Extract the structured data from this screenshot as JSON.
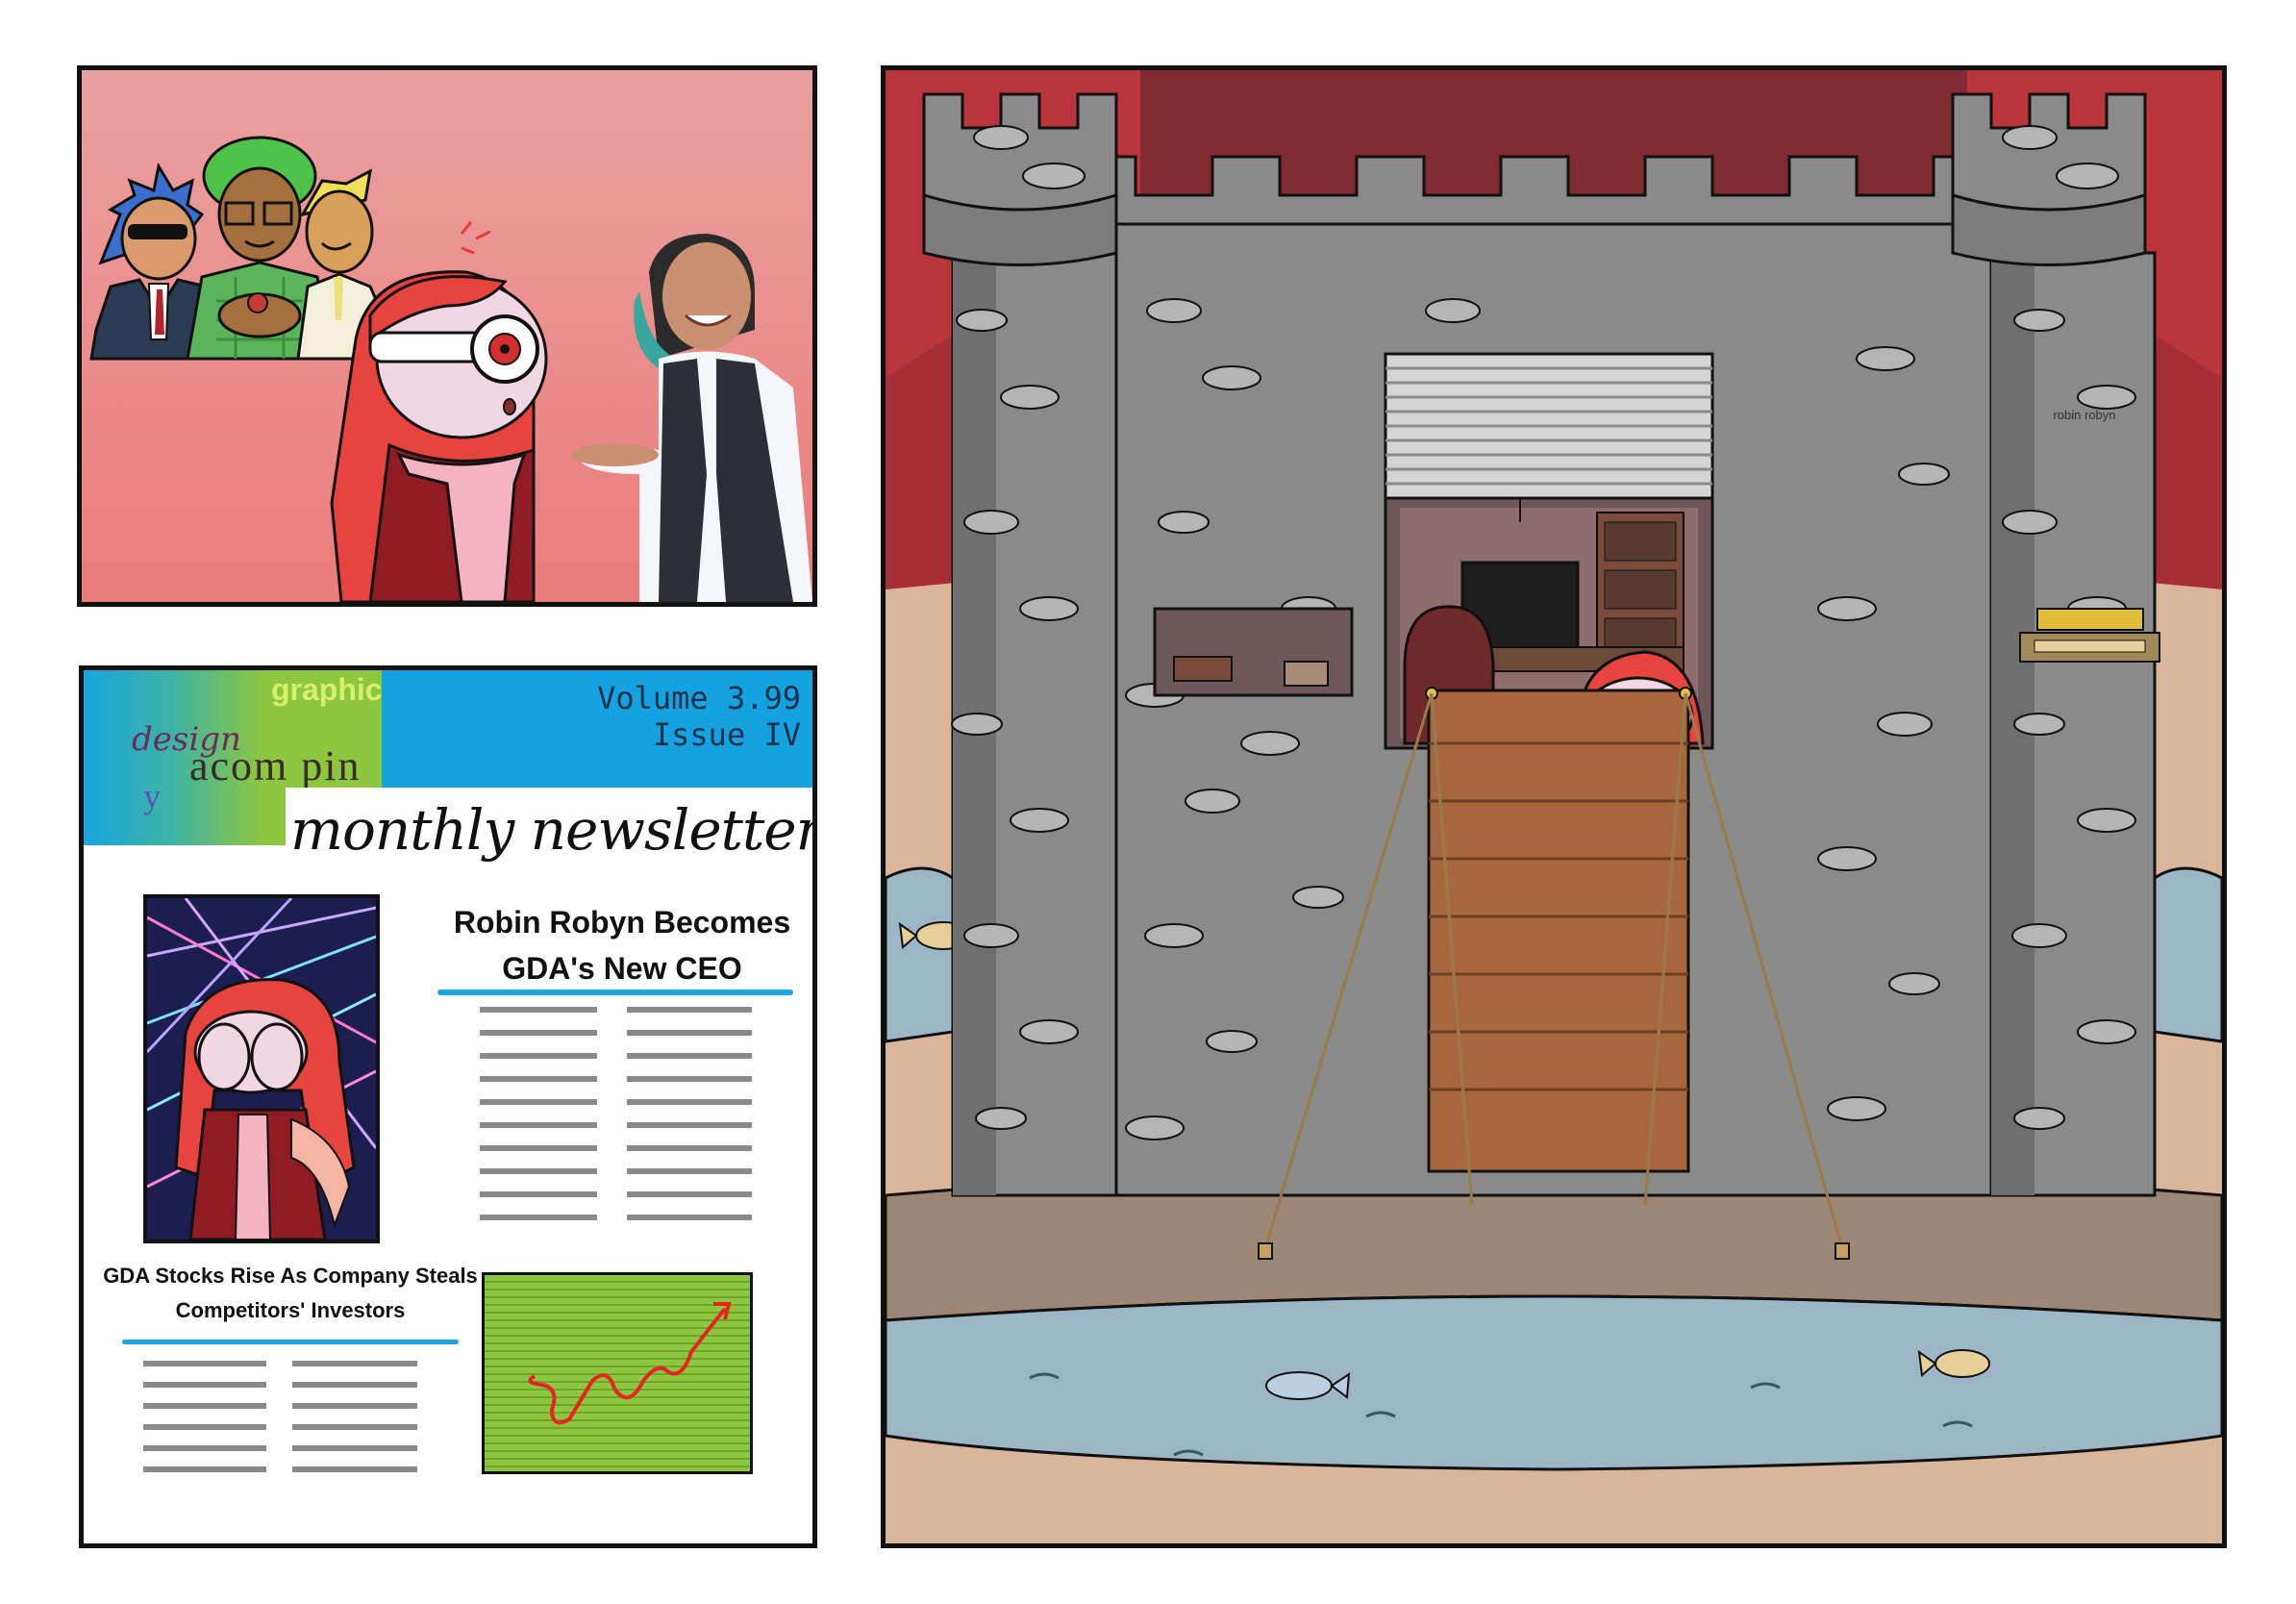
{
  "newsletter": {
    "wordmark_graphic": "graphic",
    "wordmark_design": "design",
    "wordmark_company": "acom pin",
    "wordmark_y": "y",
    "title": "monthly newsletter",
    "volume": "Volume 3.99",
    "issue": "Issue IV",
    "headline_main": "Robin Robyn Becomes GDA's New CEO",
    "headline_secondary": "GDA Stocks Rise As Company Steals Competitors' Investors"
  },
  "castle": {
    "nameplate": "robin robyn"
  },
  "colors": {
    "outline": "#111111",
    "panel1_bg": "#ea8f8e",
    "newsletter_blue": "#14a3e0",
    "newsletter_green": "#8dc63f",
    "underline_blue": "#1aa6e0",
    "castle_stone": "#8a8a8a",
    "castle_bg": "#b9353c",
    "water": "#9db6c6",
    "ground": "#d9b59c",
    "door": "#a8683d",
    "hair_red": "#e8443f"
  }
}
